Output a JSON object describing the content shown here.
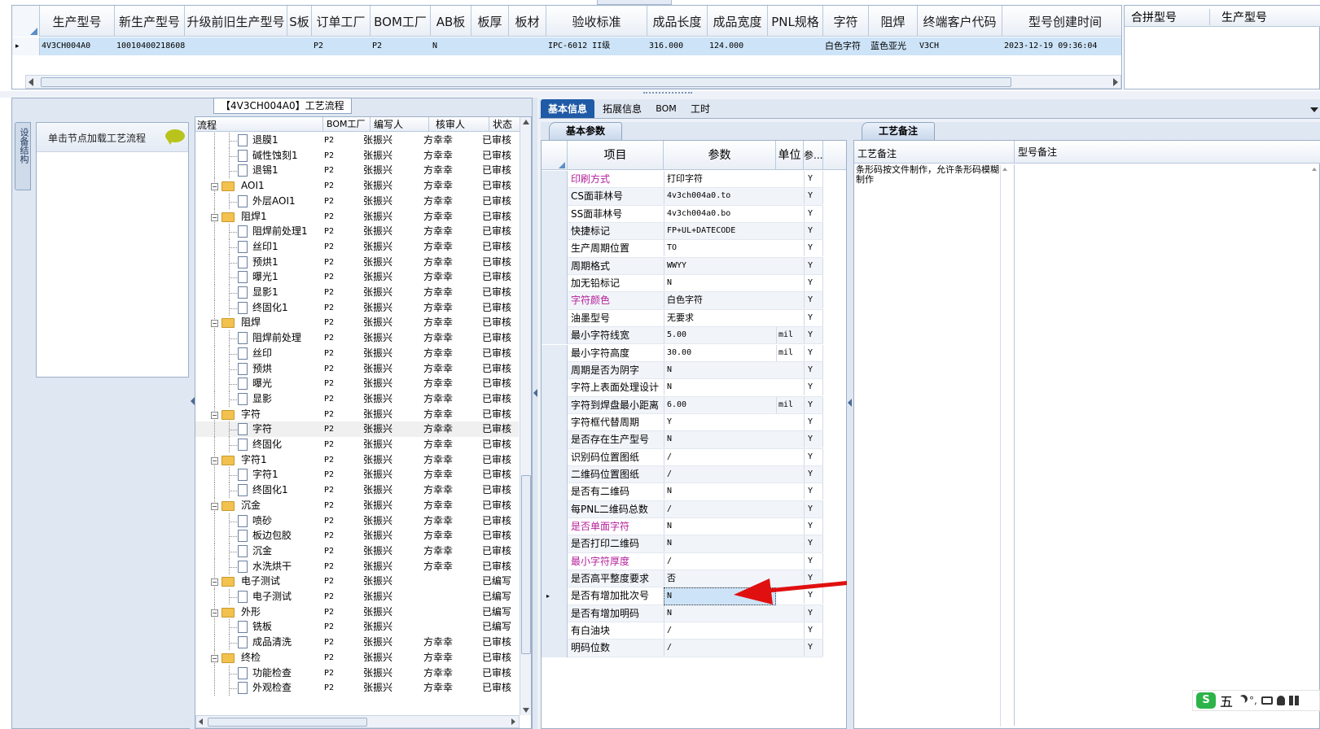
{
  "top_grid": {
    "headers": [
      "生产型号",
      "新生产型号",
      "升级前旧生产型号",
      "S板",
      "订单工厂",
      "BOM工厂",
      "AB板",
      "板厚",
      "板材",
      "验收标准",
      "成品长度",
      "成品宽度",
      "PNL规格",
      "字符",
      "阻焊",
      "终端客户代码",
      "型号创建时间"
    ],
    "row": {
      "marker": "▸",
      "prod_model": "4V3CH004A0",
      "new_prod_model": "10010400218608",
      "old_model": "",
      "s_board": "",
      "order_factory": "P2",
      "bom_factory": "P2",
      "ab_board": "N",
      "thickness": "",
      "material": "",
      "standard": "IPC-6012 II级",
      "length": "316.000",
      "width": "124.000",
      "pnl": "",
      "char": "白色字符",
      "mask": "蓝色亚光",
      "customer": "V3CH",
      "created": "2023-12-19 09:36:04"
    }
  },
  "right_top_grid": {
    "headers": [
      "合拼型号",
      "生产型号"
    ]
  },
  "flow_panel": {
    "title": "【4V3CH004A0】工艺流程",
    "side_tab": "设备结构",
    "hint": "单击节点加载工艺流程",
    "columns": [
      "流程",
      "BOM工厂",
      "编写人",
      "核审人",
      "状态"
    ],
    "rows": [
      {
        "name": "退膜1",
        "level": 2,
        "factory": "P2",
        "writer": "张振兴",
        "reviewer": "方幸幸",
        "status": "已审核"
      },
      {
        "name": "碱性蚀刻1",
        "level": 2,
        "factory": "P2",
        "writer": "张振兴",
        "reviewer": "方幸幸",
        "status": "已审核"
      },
      {
        "name": "退锡1",
        "level": 2,
        "factory": "P2",
        "writer": "张振兴",
        "reviewer": "方幸幸",
        "status": "已审核"
      },
      {
        "name": "AOI1",
        "level": 1,
        "factory": "P2",
        "writer": "张振兴",
        "reviewer": "方幸幸",
        "status": "已审核"
      },
      {
        "name": "外层AOI1",
        "level": 2,
        "factory": "P2",
        "writer": "张振兴",
        "reviewer": "方幸幸",
        "status": "已审核"
      },
      {
        "name": "阻焊1",
        "level": 1,
        "factory": "P2",
        "writer": "张振兴",
        "reviewer": "方幸幸",
        "status": "已审核"
      },
      {
        "name": "阻焊前处理1",
        "level": 2,
        "factory": "P2",
        "writer": "张振兴",
        "reviewer": "方幸幸",
        "status": "已审核"
      },
      {
        "name": "丝印1",
        "level": 2,
        "factory": "P2",
        "writer": "张振兴",
        "reviewer": "方幸幸",
        "status": "已审核"
      },
      {
        "name": "预烘1",
        "level": 2,
        "factory": "P2",
        "writer": "张振兴",
        "reviewer": "方幸幸",
        "status": "已审核"
      },
      {
        "name": "曝光1",
        "level": 2,
        "factory": "P2",
        "writer": "张振兴",
        "reviewer": "方幸幸",
        "status": "已审核"
      },
      {
        "name": "显影1",
        "level": 2,
        "factory": "P2",
        "writer": "张振兴",
        "reviewer": "方幸幸",
        "status": "已审核"
      },
      {
        "name": "终固化1",
        "level": 2,
        "factory": "P2",
        "writer": "张振兴",
        "reviewer": "方幸幸",
        "status": "已审核"
      },
      {
        "name": "阻焊",
        "level": 1,
        "factory": "P2",
        "writer": "张振兴",
        "reviewer": "方幸幸",
        "status": "已审核"
      },
      {
        "name": "阻焊前处理",
        "level": 2,
        "factory": "P2",
        "writer": "张振兴",
        "reviewer": "方幸幸",
        "status": "已审核"
      },
      {
        "name": "丝印",
        "level": 2,
        "factory": "P2",
        "writer": "张振兴",
        "reviewer": "方幸幸",
        "status": "已审核"
      },
      {
        "name": "预烘",
        "level": 2,
        "factory": "P2",
        "writer": "张振兴",
        "reviewer": "方幸幸",
        "status": "已审核"
      },
      {
        "name": "曝光",
        "level": 2,
        "factory": "P2",
        "writer": "张振兴",
        "reviewer": "方幸幸",
        "status": "已审核"
      },
      {
        "name": "显影",
        "level": 2,
        "factory": "P2",
        "writer": "张振兴",
        "reviewer": "方幸幸",
        "status": "已审核"
      },
      {
        "name": "字符",
        "level": 1,
        "factory": "P2",
        "writer": "张振兴",
        "reviewer": "方幸幸",
        "status": "已审核"
      },
      {
        "name": "字符",
        "level": 2,
        "factory": "P2",
        "writer": "张振兴",
        "reviewer": "方幸幸",
        "status": "已审核"
      },
      {
        "name": "终固化",
        "level": 2,
        "factory": "P2",
        "writer": "张振兴",
        "reviewer": "方幸幸",
        "status": "已审核"
      },
      {
        "name": "字符1",
        "level": 1,
        "factory": "P2",
        "writer": "张振兴",
        "reviewer": "方幸幸",
        "status": "已审核"
      },
      {
        "name": "字符1",
        "level": 2,
        "factory": "P2",
        "writer": "张振兴",
        "reviewer": "方幸幸",
        "status": "已审核"
      },
      {
        "name": "终固化1",
        "level": 2,
        "factory": "P2",
        "writer": "张振兴",
        "reviewer": "方幸幸",
        "status": "已审核"
      },
      {
        "name": "沉金",
        "level": 1,
        "factory": "P2",
        "writer": "张振兴",
        "reviewer": "方幸幸",
        "status": "已审核"
      },
      {
        "name": "喷砂",
        "level": 2,
        "factory": "P2",
        "writer": "张振兴",
        "reviewer": "方幸幸",
        "status": "已审核"
      },
      {
        "name": "板边包胶",
        "level": 2,
        "factory": "P2",
        "writer": "张振兴",
        "reviewer": "方幸幸",
        "status": "已审核"
      },
      {
        "name": "沉金",
        "level": 2,
        "factory": "P2",
        "writer": "张振兴",
        "reviewer": "方幸幸",
        "status": "已审核"
      },
      {
        "name": "水洗烘干",
        "level": 2,
        "factory": "P2",
        "writer": "张振兴",
        "reviewer": "方幸幸",
        "status": "已审核"
      },
      {
        "name": "电子测试",
        "level": 1,
        "factory": "P2",
        "writer": "张振兴",
        "reviewer": "",
        "status": "已编写"
      },
      {
        "name": "电子测试",
        "level": 2,
        "factory": "P2",
        "writer": "张振兴",
        "reviewer": "",
        "status": "已编写"
      },
      {
        "name": "外形",
        "level": 1,
        "factory": "P2",
        "writer": "张振兴",
        "reviewer": "",
        "status": "已编写"
      },
      {
        "name": "铣板",
        "level": 2,
        "factory": "P2",
        "writer": "张振兴",
        "reviewer": "",
        "status": "已编写"
      },
      {
        "name": "成品清洗",
        "level": 2,
        "factory": "P2",
        "writer": "张振兴",
        "reviewer": "方幸幸",
        "status": "已审核"
      },
      {
        "name": "终检",
        "level": 1,
        "factory": "P2",
        "writer": "张振兴",
        "reviewer": "方幸幸",
        "status": "已审核"
      },
      {
        "name": "功能检查",
        "level": 2,
        "factory": "P2",
        "writer": "张振兴",
        "reviewer": "方幸幸",
        "status": "已审核"
      },
      {
        "name": "外观检查",
        "level": 2,
        "factory": "P2",
        "writer": "张振兴",
        "reviewer": "方幸幸",
        "status": "已审核"
      }
    ]
  },
  "info_tabs": [
    "基本信息",
    "拓展信息",
    "BOM",
    "工时"
  ],
  "basic_params": {
    "tab": "基本参数",
    "columns": [
      "项目",
      "参数",
      "单位",
      "参..."
    ],
    "rows": [
      {
        "item": "印刷方式",
        "value": "打印字符",
        "unit": "",
        "flag": "Y",
        "pink": true
      },
      {
        "item": "CS面菲林号",
        "value": "4v3ch004a0.to",
        "unit": "",
        "flag": "Y",
        "pink": false
      },
      {
        "item": "SS面菲林号",
        "value": "4v3ch004a0.bo",
        "unit": "",
        "flag": "Y",
        "pink": false
      },
      {
        "item": "快捷标记",
        "value": "FP+UL+DATECODE",
        "unit": "",
        "flag": "Y",
        "pink": false
      },
      {
        "item": "生产周期位置",
        "value": "TO",
        "unit": "",
        "flag": "Y",
        "pink": false
      },
      {
        "item": "周期格式",
        "value": "WWYY",
        "unit": "",
        "flag": "Y",
        "pink": false
      },
      {
        "item": "加无铅标记",
        "value": "N",
        "unit": "",
        "flag": "Y",
        "pink": false
      },
      {
        "item": "字符颜色",
        "value": "白色字符",
        "unit": "",
        "flag": "Y",
        "pink": true
      },
      {
        "item": "油墨型号",
        "value": "无要求",
        "unit": "",
        "flag": "Y",
        "pink": false
      },
      {
        "item": "最小字符线宽",
        "value": "5.00",
        "unit": "mil",
        "flag": "Y",
        "pink": false
      },
      {
        "item": "最小字符高度",
        "value": "30.00",
        "unit": "mil",
        "flag": "Y",
        "pink": false
      },
      {
        "item": "周期是否为阴字",
        "value": "N",
        "unit": "",
        "flag": "Y",
        "pink": false
      },
      {
        "item": "字符上表面处理设计",
        "value": "N",
        "unit": "",
        "flag": "Y",
        "pink": false
      },
      {
        "item": "字符到焊盘最小距离",
        "value": "6.00",
        "unit": "mil",
        "flag": "Y",
        "pink": false
      },
      {
        "item": "字符框代替周期",
        "value": "Y",
        "unit": "",
        "flag": "Y",
        "pink": false
      },
      {
        "item": "是否存在生产型号",
        "value": "N",
        "unit": "",
        "flag": "Y",
        "pink": false
      },
      {
        "item": "识别码位置图纸",
        "value": "/",
        "unit": "",
        "flag": "Y",
        "pink": false
      },
      {
        "item": "二维码位置图纸",
        "value": "/",
        "unit": "",
        "flag": "Y",
        "pink": false
      },
      {
        "item": "是否有二维码",
        "value": "N",
        "unit": "",
        "flag": "Y",
        "pink": false
      },
      {
        "item": "每PNL二维码总数",
        "value": "/",
        "unit": "",
        "flag": "Y",
        "pink": false
      },
      {
        "item": "是否单面字符",
        "value": "N",
        "unit": "",
        "flag": "Y",
        "pink": true
      },
      {
        "item": "是否打印二维码",
        "value": "N",
        "unit": "",
        "flag": "Y",
        "pink": false
      },
      {
        "item": "最小字符厚度",
        "value": "/",
        "unit": "",
        "flag": "Y",
        "pink": true
      },
      {
        "item": "是否高平整度要求",
        "value": "否",
        "unit": "",
        "flag": "Y",
        "pink": false
      },
      {
        "item": "是否有增加批次号",
        "value": "N",
        "unit": "",
        "flag": "Y",
        "pink": false,
        "selected": true
      },
      {
        "item": "是否有增加明码",
        "value": "N",
        "unit": "",
        "flag": "Y",
        "pink": false
      },
      {
        "item": "有白油块",
        "value": "/",
        "unit": "",
        "flag": "Y",
        "pink": false
      },
      {
        "item": "明码位数",
        "value": "/",
        "unit": "",
        "flag": "Y",
        "pink": false
      }
    ]
  },
  "notes": {
    "tab": "工艺备注",
    "process_label": "工艺备注",
    "model_label": "型号备注",
    "process_text": "条形码按文件制作，允许条形码模糊制作"
  },
  "ime": {
    "label": "五",
    "icons": [
      "moon-icon",
      "punct-icon",
      "keyboard-icon",
      "user-icon",
      "grid-icon"
    ]
  },
  "colors": {
    "selected_row": "#cde3f7",
    "pink_label": "#b5209a",
    "tab_active": "#1f5aa6",
    "arrow": "#e01010",
    "ime_green": "#2db34a"
  }
}
